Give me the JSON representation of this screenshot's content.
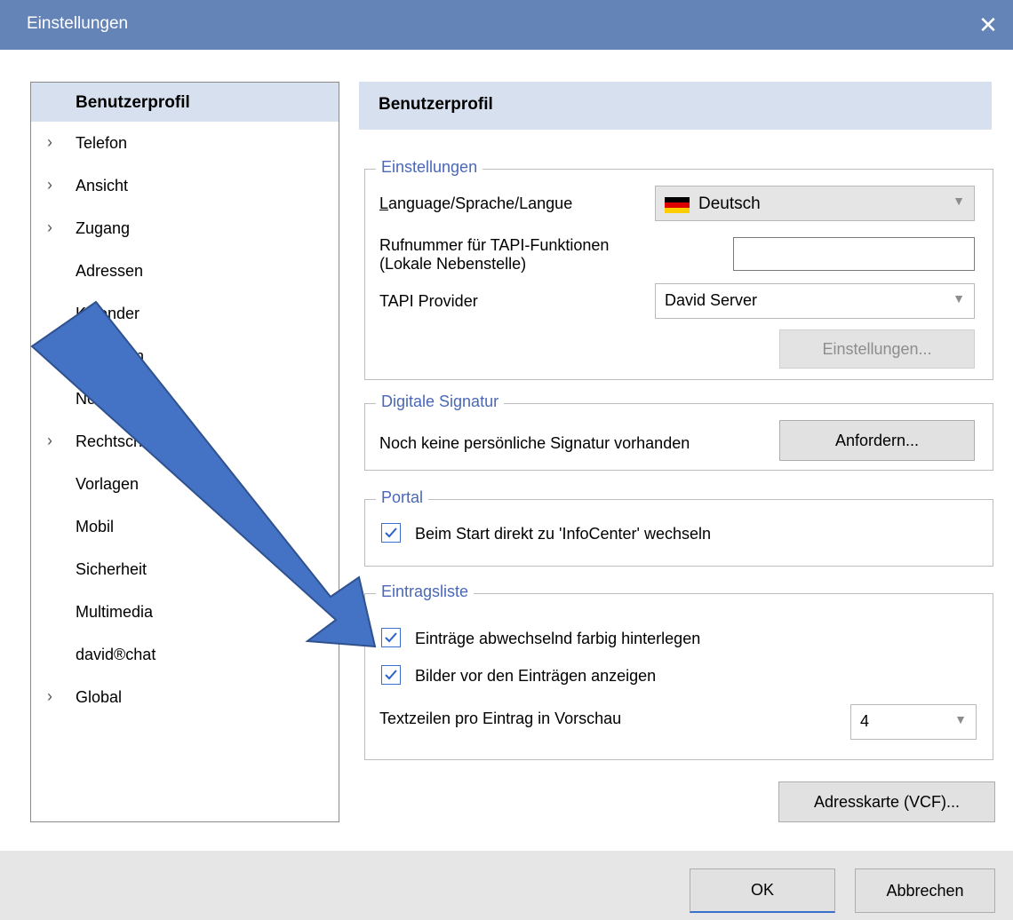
{
  "window": {
    "title": "Einstellungen",
    "close_glyph": "✕"
  },
  "nav": {
    "items": [
      {
        "label": "Benutzerprofil",
        "active": true,
        "expandable": false
      },
      {
        "label": "Telefon",
        "expandable": true
      },
      {
        "label": "Ansicht",
        "expandable": true
      },
      {
        "label": "Zugang",
        "expandable": true
      },
      {
        "label": "Adressen",
        "expandable": false
      },
      {
        "label": "Kalender",
        "expandable": false
      },
      {
        "label": "Aufgaben",
        "expandable": false
      },
      {
        "label": "Notizen",
        "expandable": false
      },
      {
        "label": "Rechtschreibung",
        "expandable": true
      },
      {
        "label": "Vorlagen",
        "expandable": false
      },
      {
        "label": "Mobil",
        "expandable": false
      },
      {
        "label": "Sicherheit",
        "expandable": false
      },
      {
        "label": "Multimedia",
        "expandable": false
      },
      {
        "label": "david®chat",
        "expandable": false
      },
      {
        "label": "Global",
        "expandable": true
      }
    ]
  },
  "panel": {
    "title": "Benutzerprofil",
    "settings": {
      "legend": "Einstellungen",
      "language_label": "Language/Sprache/Langue",
      "language_value": "Deutsch",
      "language_flag": "de-flag-icon",
      "tapi_number_label_1": "Rufnummer für TAPI-Funktionen",
      "tapi_number_label_2": "(Lokale Nebenstelle)",
      "tapi_number_value": "",
      "tapi_provider_label": "TAPI Provider",
      "tapi_provider_value": "David Server",
      "settings_button": "Einstellungen..."
    },
    "signature": {
      "legend": "Digitale Signatur",
      "text": "Noch keine persönliche Signatur vorhanden",
      "request_button": "Anfordern..."
    },
    "portal": {
      "legend": "Portal",
      "start_infocenter_label": "Beim Start direkt zu 'InfoCenter' wechseln",
      "start_infocenter_checked": true
    },
    "entry_list": {
      "legend": "Eintragsliste",
      "alternate_colors_label": "Einträge abwechselnd farbig hinterlegen",
      "alternate_colors_checked": true,
      "show_images_label": "Bilder vor den Einträgen anzeigen",
      "show_images_checked": true,
      "preview_lines_label": "Textzeilen pro Eintrag in Vorschau",
      "preview_lines_value": "4"
    },
    "vcf_button": "Adresskarte (VCF)..."
  },
  "footer": {
    "ok": "OK",
    "cancel": "Abbrechen"
  },
  "colors": {
    "titlebar": "#6483b6",
    "accent": "#4a67b8",
    "arrow": "#4472c4"
  }
}
